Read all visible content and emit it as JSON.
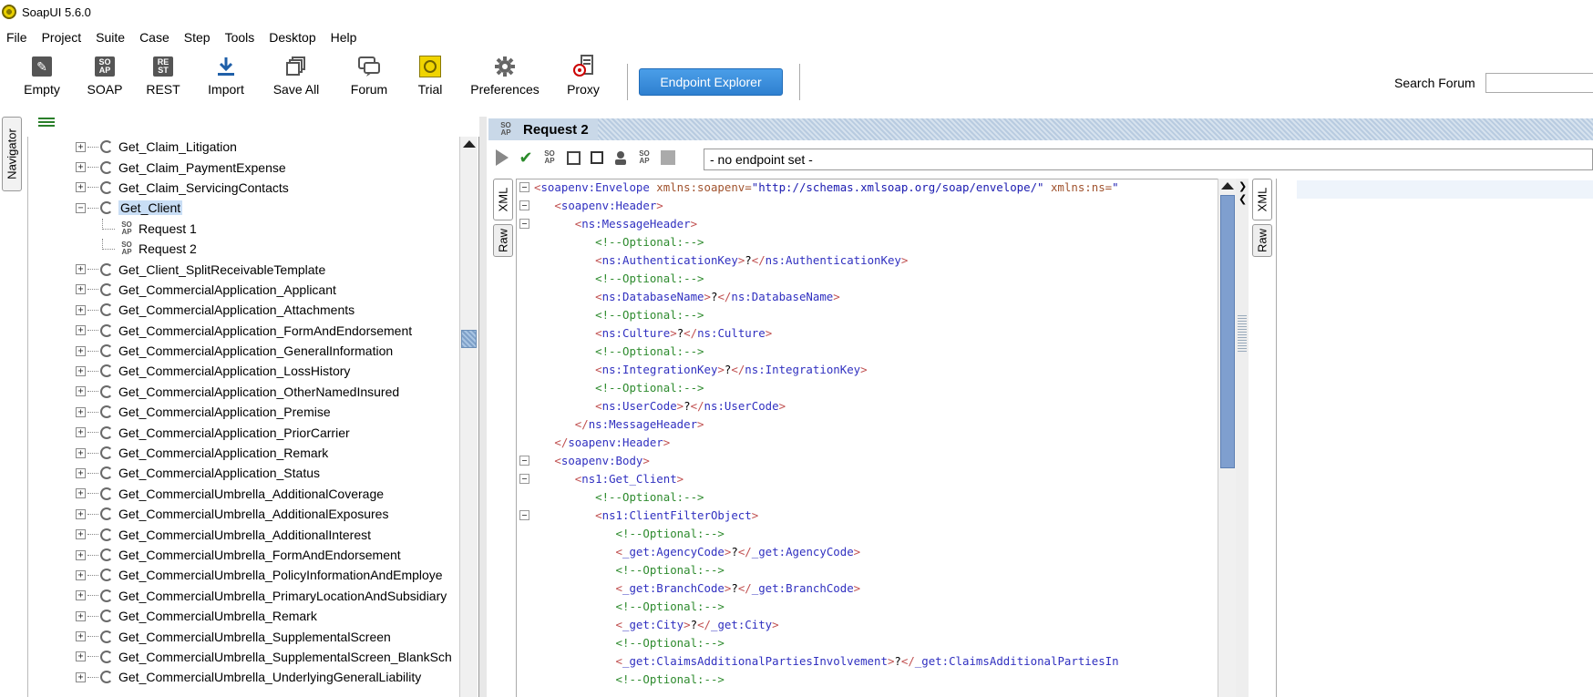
{
  "window": {
    "title": "SoapUI 5.6.0"
  },
  "menu": [
    "File",
    "Project",
    "Suite",
    "Case",
    "Step",
    "Tools",
    "Desktop",
    "Help"
  ],
  "toolbar": {
    "buttons": [
      {
        "label": "Empty",
        "icon": "empty-project-icon"
      },
      {
        "label": "SOAP",
        "icon": "soap-icon"
      },
      {
        "label": "REST",
        "icon": "rest-icon"
      },
      {
        "label": "Import",
        "icon": "import-icon"
      },
      {
        "label": "Save All",
        "icon": "save-all-icon"
      },
      {
        "label": "Forum",
        "icon": "forum-icon"
      },
      {
        "label": "Trial",
        "icon": "trial-icon"
      },
      {
        "label": "Preferences",
        "icon": "gear-icon"
      },
      {
        "label": "Proxy",
        "icon": "proxy-icon"
      }
    ],
    "endpoint_explorer": "Endpoint Explorer",
    "search_label": "Search Forum",
    "search_value": ""
  },
  "navigator": {
    "tab_label": "Navigator",
    "items_before": [
      "Get_Claim_Litigation",
      "Get_Claim_PaymentExpense",
      "Get_Claim_ServicingContacts"
    ],
    "selected": "Get_Client",
    "requests": [
      "Request 1",
      "Request 2"
    ],
    "items_after": [
      "Get_Client_SplitReceivableTemplate",
      "Get_CommercialApplication_Applicant",
      "Get_CommercialApplication_Attachments",
      "Get_CommercialApplication_FormAndEndorsement",
      "Get_CommercialApplication_GeneralInformation",
      "Get_CommercialApplication_LossHistory",
      "Get_CommercialApplication_OtherNamedInsured",
      "Get_CommercialApplication_Premise",
      "Get_CommercialApplication_PriorCarrier",
      "Get_CommercialApplication_Remark",
      "Get_CommercialApplication_Status",
      "Get_CommercialUmbrella_AdditionalCoverage",
      "Get_CommercialUmbrella_AdditionalExposures",
      "Get_CommercialUmbrella_AdditionalInterest",
      "Get_CommercialUmbrella_FormAndEndorsement",
      "Get_CommercialUmbrella_PolicyInformationAndEmploye",
      "Get_CommercialUmbrella_PrimaryLocationAndSubsidiary",
      "Get_CommercialUmbrella_Remark",
      "Get_CommercialUmbrella_SupplementalScreen",
      "Get_CommercialUmbrella_SupplementalScreen_BlankSch",
      "Get_CommercialUmbrella_UnderlyingGeneralLiability"
    ]
  },
  "request": {
    "title": "Request 2",
    "endpoint": "- no endpoint set -",
    "tabs": [
      "XML",
      "Raw"
    ],
    "response_tabs": [
      "XML",
      "Raw"
    ],
    "lines": [
      {
        "indent": 0,
        "kind": "open",
        "name": "soapenv:Envelope",
        "attr": " xmlns:soapenv=",
        "val": "\"http://schemas.xmlsoap.org/soap/envelope/\"",
        "attr2": " xmlns:ns=",
        "val2": "\"",
        "fold": true
      },
      {
        "indent": 1,
        "kind": "open",
        "name": "soapenv:Header",
        "fold": true
      },
      {
        "indent": 2,
        "kind": "open",
        "name": "ns:MessageHeader",
        "fold": true
      },
      {
        "indent": 3,
        "kind": "comment",
        "text": "<!--Optional:-->"
      },
      {
        "indent": 3,
        "kind": "element",
        "name": "ns:AuthenticationKey",
        "text": "?"
      },
      {
        "indent": 3,
        "kind": "comment",
        "text": "<!--Optional:-->"
      },
      {
        "indent": 3,
        "kind": "element",
        "name": "ns:DatabaseName",
        "text": "?"
      },
      {
        "indent": 3,
        "kind": "comment",
        "text": "<!--Optional:-->"
      },
      {
        "indent": 3,
        "kind": "element",
        "name": "ns:Culture",
        "text": "?"
      },
      {
        "indent": 3,
        "kind": "comment",
        "text": "<!--Optional:-->"
      },
      {
        "indent": 3,
        "kind": "element",
        "name": "ns:IntegrationKey",
        "text": "?"
      },
      {
        "indent": 3,
        "kind": "comment",
        "text": "<!--Optional:-->"
      },
      {
        "indent": 3,
        "kind": "element",
        "name": "ns:UserCode",
        "text": "?"
      },
      {
        "indent": 2,
        "kind": "close",
        "name": "ns:MessageHeader"
      },
      {
        "indent": 1,
        "kind": "close",
        "name": "soapenv:Header"
      },
      {
        "indent": 1,
        "kind": "open",
        "name": "soapenv:Body",
        "fold": true
      },
      {
        "indent": 2,
        "kind": "open",
        "name": "ns1:Get_Client",
        "fold": true
      },
      {
        "indent": 3,
        "kind": "comment",
        "text": "<!--Optional:-->"
      },
      {
        "indent": 3,
        "kind": "open",
        "name": "ns1:ClientFilterObject",
        "fold": true
      },
      {
        "indent": 4,
        "kind": "comment",
        "text": "<!--Optional:-->"
      },
      {
        "indent": 4,
        "kind": "element",
        "name": "_get:AgencyCode",
        "text": "?"
      },
      {
        "indent": 4,
        "kind": "comment",
        "text": "<!--Optional:-->"
      },
      {
        "indent": 4,
        "kind": "element",
        "name": "_get:BranchCode",
        "text": "?"
      },
      {
        "indent": 4,
        "kind": "comment",
        "text": "<!--Optional:-->"
      },
      {
        "indent": 4,
        "kind": "element",
        "name": "_get:City",
        "text": "?"
      },
      {
        "indent": 4,
        "kind": "comment",
        "text": "<!--Optional:-->"
      },
      {
        "indent": 4,
        "kind": "element",
        "name": "_get:ClaimsAdditionalPartiesInvolvement",
        "text": "?",
        "close_name": "_get:ClaimsAdditionalPartiesIn",
        "truncated": true
      },
      {
        "indent": 4,
        "kind": "comment",
        "text": "<!--Optional:-->"
      }
    ]
  }
}
